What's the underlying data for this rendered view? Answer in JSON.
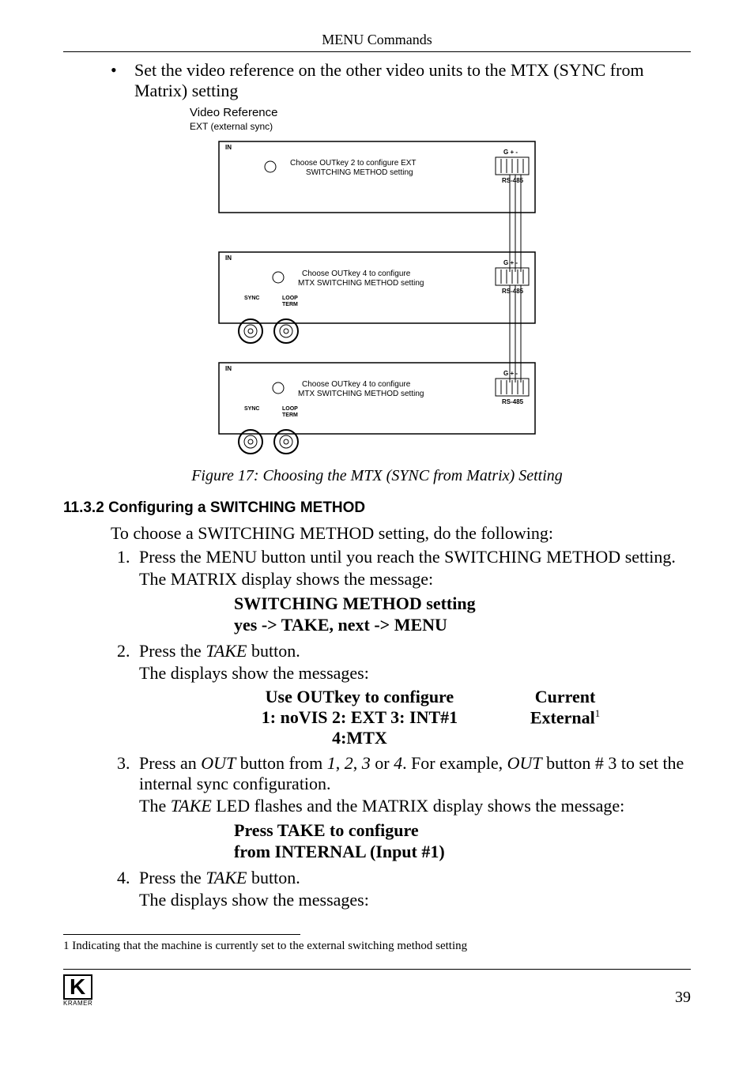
{
  "header": {
    "title": "MENU Commands"
  },
  "bullet": {
    "dot": "•",
    "text": "Set the video reference on the other video units to the MTX (SYNC from Matrix) setting"
  },
  "videoRef": {
    "title": "Video Reference",
    "sub": "EXT (external sync)"
  },
  "diagram": {
    "in": "IN",
    "gplus": "G + -",
    "rs485": "RS-485",
    "sync": "SYNC",
    "loop": "LOOP",
    "term": "TERM",
    "box1_line1": "Choose  OUTkey  2 to configure EXT",
    "box1_line2": "SWITCHING METHOD setting",
    "box2_line1": "Choose  OUTkey  4 to configure",
    "box2_line2": "MTX SWITCHING METHOD setting",
    "box3_line1": "Choose  OUTkey  4 to configure",
    "box3_line2": "MTX SWITCHING METHOD setting"
  },
  "caption": "Figure 17: Choosing the MTX (SYNC from Matrix) Setting",
  "secNum": "11.3.2",
  "secTitle": "Configuring a SWITCHING METHOD",
  "intro": "To choose a SWITCHING METHOD setting, do the following:",
  "step1": {
    "a": "Press the MENU button until you reach the SWITCHING METHOD setting.",
    "b": "The MATRIX display shows the message:",
    "msg1": "SWITCHING METHOD setting",
    "msg2": "yes -> TAKE, next -> MENU"
  },
  "step2": {
    "a_pre": "Press the ",
    "a_it": "TAKE",
    "a_post": " button.",
    "b": "The displays show the messages:",
    "left1": "Use OUTkey to configure",
    "left2": "1: noVIS  2: EXT  3: INT#1  4:MTX",
    "right1": "Current",
    "right2": "External",
    "sup": "1"
  },
  "step3": {
    "a_1": "Press an ",
    "a_it1": "OUT",
    "a_2": " button from ",
    "a_it2": "1",
    "a_3": ", ",
    "a_it3": "2",
    "a_4": ", ",
    "a_it4": "3",
    "a_5": " or ",
    "a_it5": "4",
    "a_6": ". For example, ",
    "a_it6": "OUT",
    "a_7": " button # 3 to set the internal sync configuration.",
    "b_1": "The ",
    "b_it": "TAKE",
    "b_2": " LED flashes and the MATRIX display shows the message:",
    "msg1": "Press TAKE to configure",
    "msg2": "from INTERNAL (Input #1)"
  },
  "step4": {
    "a_pre": "Press the ",
    "a_it": "TAKE",
    "a_post": " button.",
    "b": "The displays show the messages:"
  },
  "footnote": "1 Indicating that the machine is currently set to the external switching method setting",
  "footer": {
    "logo": "K",
    "logoSub": "KRAMER",
    "page": "39"
  }
}
